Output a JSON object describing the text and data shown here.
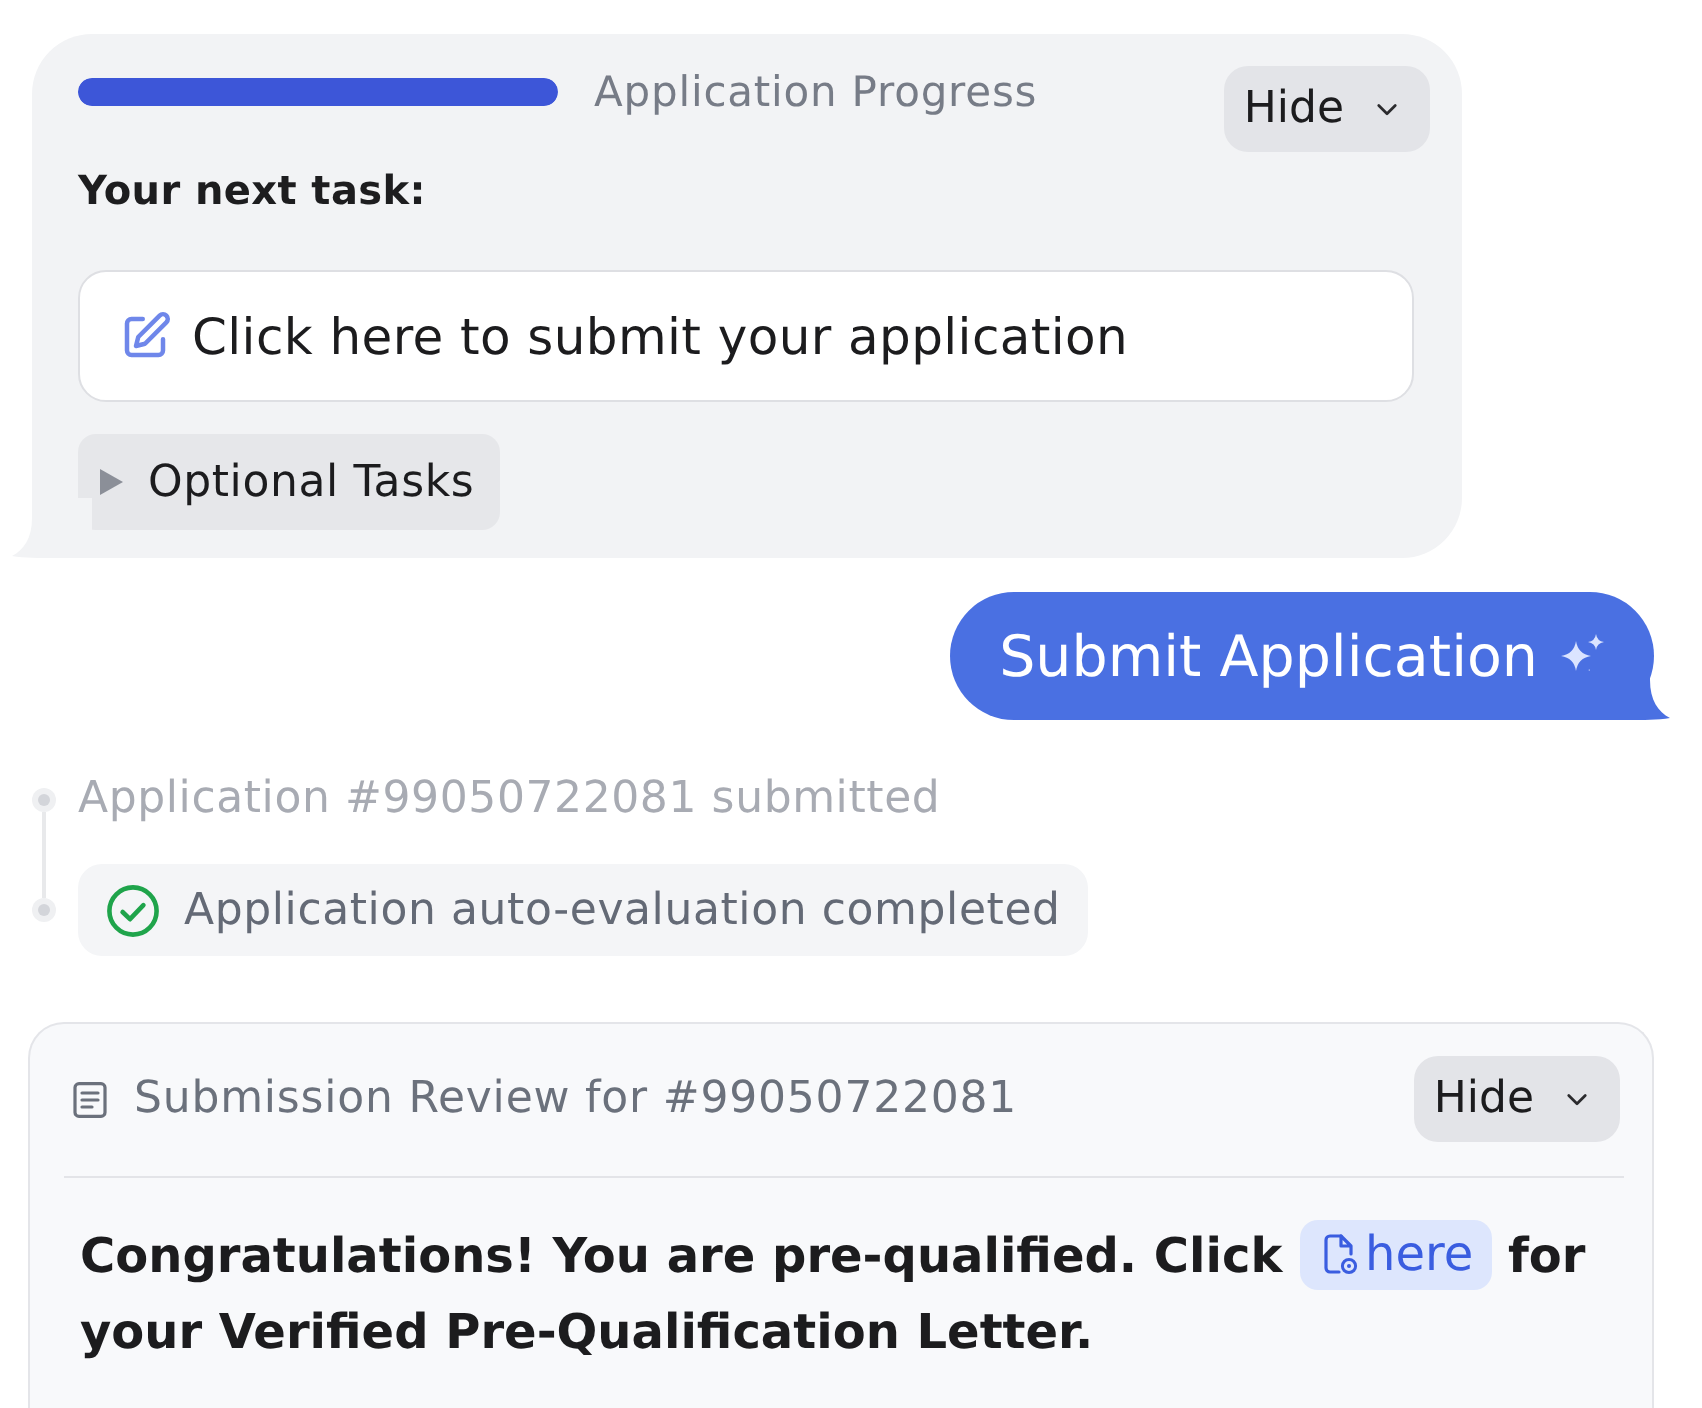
{
  "progress_card": {
    "progress": {
      "level": 1,
      "label": "Application Progress"
    },
    "hide_button": "Hide",
    "next_task_heading": "Your next task:",
    "next_task": "Click here to submit your application",
    "optional_tasks": {
      "label": "Optional Tasks",
      "expanded": false
    }
  },
  "sent_message": "Submit Application",
  "timeline": [
    {
      "kind": "plain",
      "text": "Application #99050722081 submitted"
    },
    {
      "kind": "check",
      "text": "Application auto-evaluation completed"
    }
  ],
  "review_card": {
    "title": "Submission Review for #99050722081",
    "hide_button": "Hide",
    "message": {
      "before": "Congratulations! You are pre-qualified. Click",
      "link": "here",
      "after": "for your Verified Pre-Qualification Letter."
    }
  }
}
